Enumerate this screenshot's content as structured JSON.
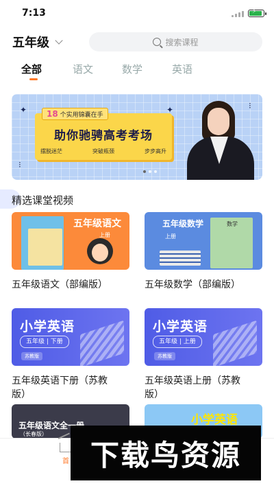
{
  "status_bar": {
    "time": "7:13"
  },
  "header": {
    "grade": "五年级",
    "search_placeholder": "搜索课程"
  },
  "tabs": [
    {
      "label": "全部",
      "active": true
    },
    {
      "label": "语文",
      "active": false
    },
    {
      "label": "数学",
      "active": false
    },
    {
      "label": "英语",
      "active": false
    }
  ],
  "colors": {
    "accent": "#ff7a2a",
    "banner": "#b9d2f6",
    "english_card": "#4f5ce6"
  },
  "banner": {
    "badge_num": "18",
    "badge_text": "个实用锦囊在手",
    "headline": "助你驰骋高考考场",
    "tags": [
      "摆脱迷茫",
      "突破瓶颈",
      "步步高升"
    ]
  },
  "section": {
    "title": "精选课堂视频"
  },
  "courses": [
    {
      "title": "五年级语文（部编版）",
      "thumb_title": "五年级语文",
      "thumb_sub": "上册"
    },
    {
      "title": "五年级数学（部编版）",
      "thumb_title": "五年级数学",
      "thumb_sub": "上册",
      "book_label": "数学"
    },
    {
      "title": "五年级英语下册（苏教版）",
      "thumb_title": "小学英语",
      "thumb_grade": "五年级 | 下册",
      "thumb_tag": "苏教版"
    },
    {
      "title": "五年级英语上册（苏教版）",
      "thumb_title": "小学英语",
      "thumb_grade": "五年级 | 上册",
      "thumb_tag": "苏教版"
    },
    {
      "thumb_title": "五年级语文全一册",
      "thumb_sub": "（长春版）"
    },
    {
      "thumb_title": "小学英语"
    }
  ],
  "bottom_nav": {
    "home_label": "首"
  },
  "watermark": {
    "text": "下载鸟资源"
  }
}
